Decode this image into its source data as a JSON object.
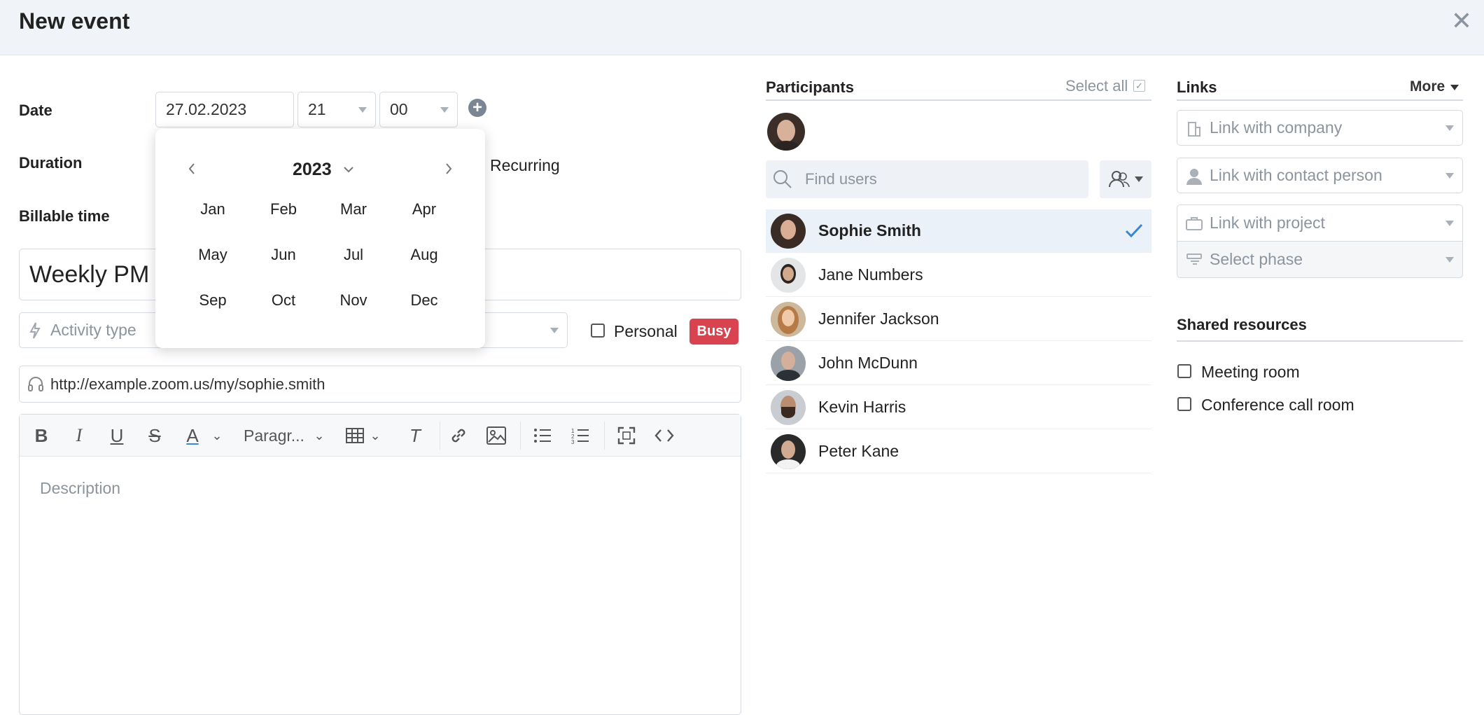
{
  "header": {
    "title": "New event",
    "close_label": "✕"
  },
  "form": {
    "date_label": "Date",
    "duration_label": "Duration",
    "billable_label": "Billable time",
    "date_value": "27.02.2023",
    "hour_value": "21",
    "minute_value": "00",
    "recurring_label": "Recurring",
    "title_value": "Weekly PM",
    "activity_placeholder": "Activity type",
    "personal_label": "Personal",
    "busy_badge": "Busy",
    "url_value": "http://example.zoom.us/my/sophie.smith",
    "paragraph_label": "Paragr...",
    "description_placeholder": "Description"
  },
  "calendar_popup": {
    "year": "2023",
    "months": [
      "Jan",
      "Feb",
      "Mar",
      "Apr",
      "May",
      "Jun",
      "Jul",
      "Aug",
      "Sep",
      "Oct",
      "Nov",
      "Dec"
    ]
  },
  "participants": {
    "title": "Participants",
    "select_all": "Select all",
    "search_placeholder": "Find users",
    "people": [
      {
        "name": "Sophie Smith",
        "selected": true
      },
      {
        "name": "Jane Numbers",
        "selected": false
      },
      {
        "name": "Jennifer Jackson",
        "selected": false
      },
      {
        "name": "John McDunn",
        "selected": false
      },
      {
        "name": "Kevin Harris",
        "selected": false
      },
      {
        "name": "Peter Kane",
        "selected": false
      }
    ]
  },
  "links": {
    "title": "Links",
    "more": "More",
    "company": "Link with company",
    "contact": "Link with contact person",
    "project": "Link with project",
    "phase": "Select phase"
  },
  "shared_resources": {
    "title": "Shared resources",
    "items": [
      "Meeting room",
      "Conference call room"
    ]
  },
  "colors": {
    "accent": "#3a86d6",
    "busy": "#d9424f",
    "selected_row": "#eaf1f8"
  }
}
